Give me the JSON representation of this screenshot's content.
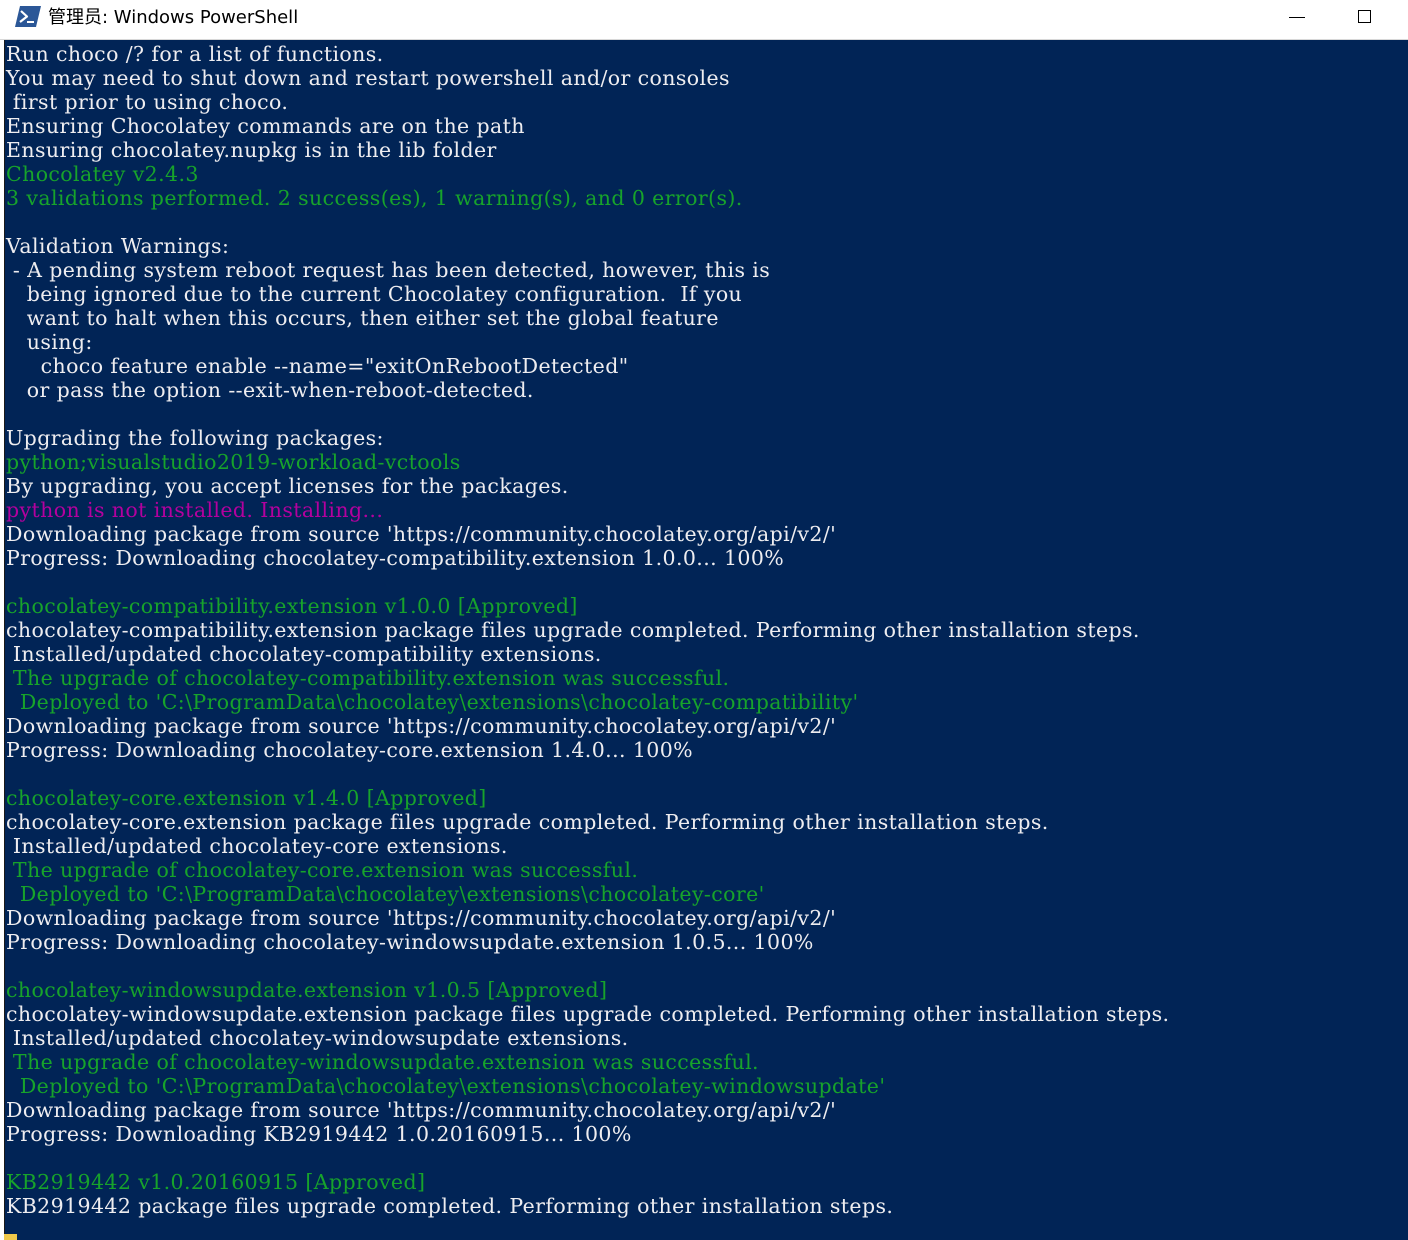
{
  "window": {
    "title": "管理员: Windows PowerShell",
    "console_background": "#012456"
  },
  "titlebar": {
    "icon": "powershell-icon",
    "minimize_icon": "minimize-icon",
    "maximize_icon": "maximize-icon"
  },
  "colors": {
    "white": "#eeedf0",
    "green": "#17a32b",
    "magenta": "#b4009e"
  },
  "console": {
    "lines": [
      {
        "text": "Run choco /? for a list of functions.",
        "color": "white"
      },
      {
        "text": "You may need to shut down and restart powershell and/or consoles",
        "color": "white"
      },
      {
        "text": " first prior to using choco.",
        "color": "white"
      },
      {
        "text": "Ensuring Chocolatey commands are on the path",
        "color": "white"
      },
      {
        "text": "Ensuring chocolatey.nupkg is in the lib folder",
        "color": "white"
      },
      {
        "text": "Chocolatey v2.4.3",
        "color": "green"
      },
      {
        "text": "3 validations performed. 2 success(es), 1 warning(s), and 0 error(s).",
        "color": "green"
      },
      {
        "text": "",
        "color": "white"
      },
      {
        "text": "Validation Warnings:",
        "color": "white"
      },
      {
        "text": " - A pending system reboot request has been detected, however, this is",
        "color": "white"
      },
      {
        "text": "   being ignored due to the current Chocolatey configuration.  If you",
        "color": "white"
      },
      {
        "text": "   want to halt when this occurs, then either set the global feature",
        "color": "white"
      },
      {
        "text": "   using:",
        "color": "white"
      },
      {
        "text": "     choco feature enable --name=\"exitOnRebootDetected\"",
        "color": "white"
      },
      {
        "text": "   or pass the option --exit-when-reboot-detected.",
        "color": "white"
      },
      {
        "text": "",
        "color": "white"
      },
      {
        "text": "Upgrading the following packages:",
        "color": "white"
      },
      {
        "text": "python;visualstudio2019-workload-vctools",
        "color": "green"
      },
      {
        "text": "By upgrading, you accept licenses for the packages.",
        "color": "white"
      },
      {
        "text": "python is not installed. Installing...",
        "color": "magenta"
      },
      {
        "text": "Downloading package from source 'https://community.chocolatey.org/api/v2/'",
        "color": "white"
      },
      {
        "text": "Progress: Downloading chocolatey-compatibility.extension 1.0.0... 100%",
        "color": "white"
      },
      {
        "text": "",
        "color": "white"
      },
      {
        "text": "chocolatey-compatibility.extension v1.0.0 [Approved]",
        "color": "green"
      },
      {
        "text": "chocolatey-compatibility.extension package files upgrade completed. Performing other installation steps.",
        "color": "white"
      },
      {
        "text": " Installed/updated chocolatey-compatibility extensions.",
        "color": "white"
      },
      {
        "text": " The upgrade of chocolatey-compatibility.extension was successful.",
        "color": "green"
      },
      {
        "text": "  Deployed to 'C:\\ProgramData\\chocolatey\\extensions\\chocolatey-compatibility'",
        "color": "green"
      },
      {
        "text": "Downloading package from source 'https://community.chocolatey.org/api/v2/'",
        "color": "white"
      },
      {
        "text": "Progress: Downloading chocolatey-core.extension 1.4.0... 100%",
        "color": "white"
      },
      {
        "text": "",
        "color": "white"
      },
      {
        "text": "chocolatey-core.extension v1.4.0 [Approved]",
        "color": "green"
      },
      {
        "text": "chocolatey-core.extension package files upgrade completed. Performing other installation steps.",
        "color": "white"
      },
      {
        "text": " Installed/updated chocolatey-core extensions.",
        "color": "white"
      },
      {
        "text": " The upgrade of chocolatey-core.extension was successful.",
        "color": "green"
      },
      {
        "text": "  Deployed to 'C:\\ProgramData\\chocolatey\\extensions\\chocolatey-core'",
        "color": "green"
      },
      {
        "text": "Downloading package from source 'https://community.chocolatey.org/api/v2/'",
        "color": "white"
      },
      {
        "text": "Progress: Downloading chocolatey-windowsupdate.extension 1.0.5... 100%",
        "color": "white"
      },
      {
        "text": "",
        "color": "white"
      },
      {
        "text": "chocolatey-windowsupdate.extension v1.0.5 [Approved]",
        "color": "green"
      },
      {
        "text": "chocolatey-windowsupdate.extension package files upgrade completed. Performing other installation steps.",
        "color": "white"
      },
      {
        "text": " Installed/updated chocolatey-windowsupdate extensions.",
        "color": "white"
      },
      {
        "text": " The upgrade of chocolatey-windowsupdate.extension was successful.",
        "color": "green"
      },
      {
        "text": "  Deployed to 'C:\\ProgramData\\chocolatey\\extensions\\chocolatey-windowsupdate'",
        "color": "green"
      },
      {
        "text": "Downloading package from source 'https://community.chocolatey.org/api/v2/'",
        "color": "white"
      },
      {
        "text": "Progress: Downloading KB2919442 1.0.20160915... 100%",
        "color": "white"
      },
      {
        "text": "",
        "color": "white"
      },
      {
        "text": "KB2919442 v1.0.20160915 [Approved]",
        "color": "green"
      },
      {
        "text": "KB2919442 package files upgrade completed. Performing other installation steps.",
        "color": "white"
      }
    ]
  }
}
